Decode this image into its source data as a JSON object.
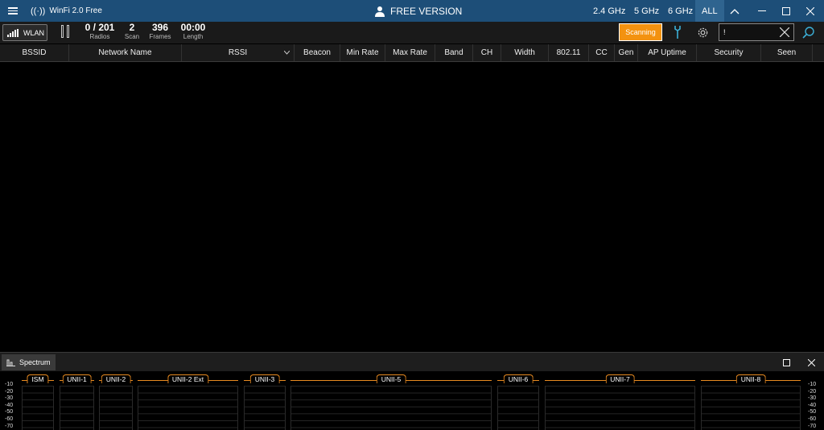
{
  "titlebar": {
    "app_name": "WinFi 2.0 Free",
    "center_label": "FREE VERSION",
    "bands": [
      "2.4 GHz",
      "5 GHz",
      "6 GHz",
      "ALL"
    ],
    "selected_band": "ALL"
  },
  "toolbar": {
    "wlan_label": "WLAN",
    "stats": [
      {
        "value": "0 / 201",
        "label": "Radios"
      },
      {
        "value": "2",
        "label": "Scan"
      },
      {
        "value": "396",
        "label": "Frames"
      },
      {
        "value": "00:00",
        "label": "Length"
      }
    ],
    "scan_button_label": "Scanning",
    "search_value": "!"
  },
  "table": {
    "columns": [
      "BSSID",
      "Network Name",
      "RSSI",
      "Beacon",
      "Min Rate",
      "Max Rate",
      "Band",
      "CH",
      "Width",
      "802.11",
      "CC",
      "Gen",
      "AP Uptime",
      "Security",
      "Seen"
    ],
    "sorted_column": "RSSI",
    "rows": []
  },
  "spectrum": {
    "title": "Spectrum",
    "y_ticks": [
      "-10",
      "-20",
      "-30",
      "-40",
      "-50",
      "-60",
      "-70"
    ],
    "bands": [
      "ISM",
      "UNII-1",
      "UNII-2",
      "UNII-2 Ext",
      "UNII-3",
      "UNII-5",
      "UNII-6",
      "UNII-7",
      "UNII-8"
    ]
  },
  "colors": {
    "titlebar": "#1d4e78",
    "accent": "#f39210",
    "band_bracket": "#e88a20"
  }
}
